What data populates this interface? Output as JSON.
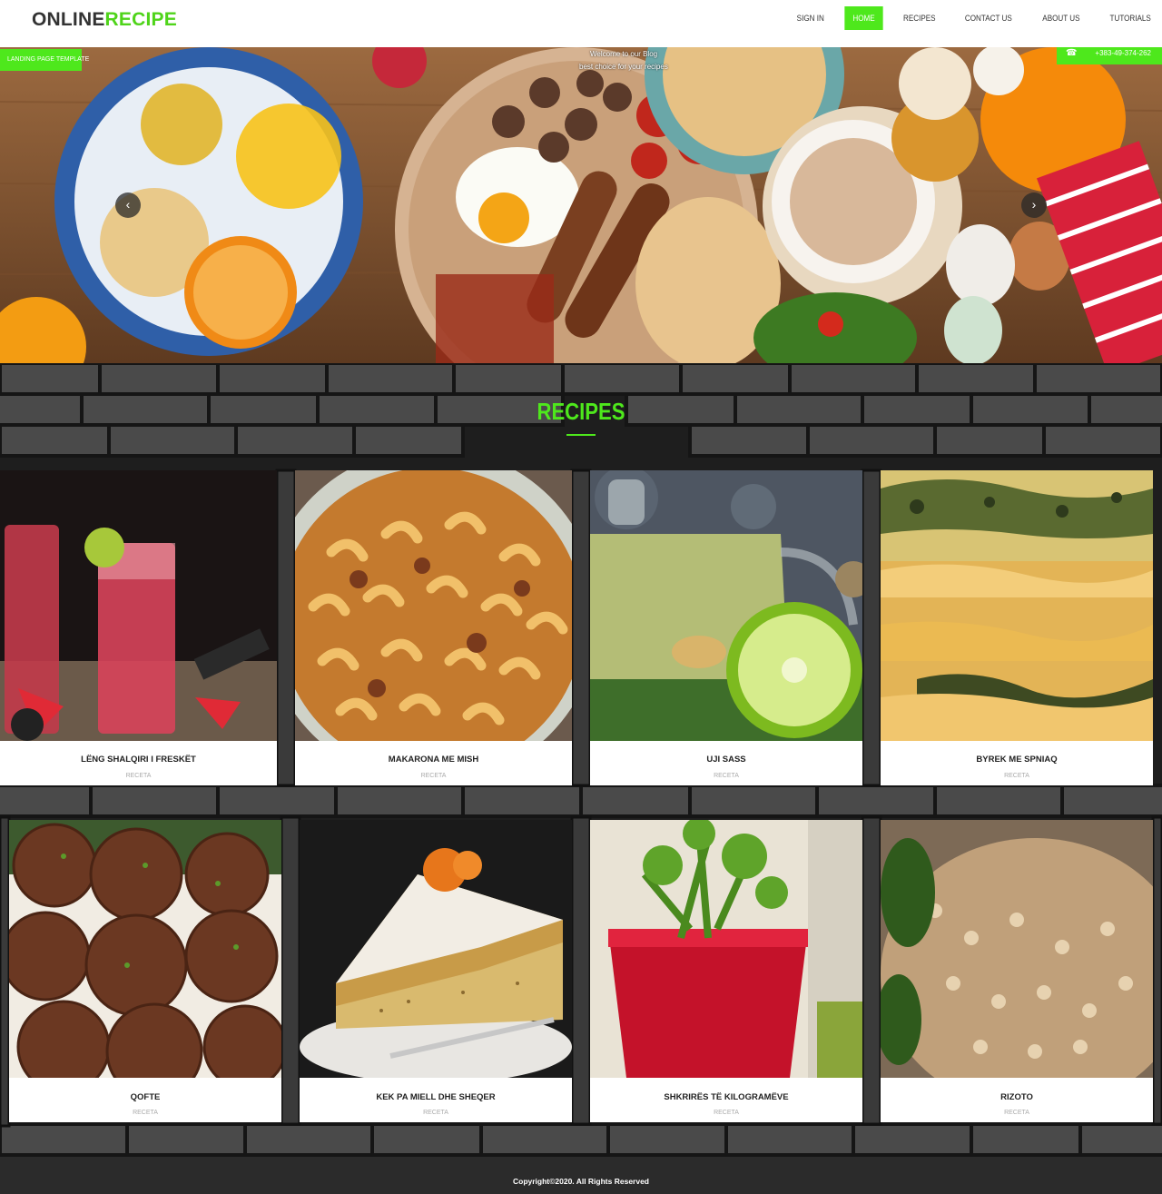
{
  "header": {
    "logo_part1": "ONLINE",
    "logo_part2": "RECIPE",
    "nav": [
      {
        "label": "SIGN IN",
        "active": false
      },
      {
        "label": "HOME",
        "active": true
      },
      {
        "label": "RECIPES",
        "active": false
      },
      {
        "label": "CONTACT US",
        "active": false
      },
      {
        "label": "ABOUT US",
        "active": false
      },
      {
        "label": "TUTORIALS",
        "active": false
      }
    ]
  },
  "hero": {
    "tag_left": "LANDING PAGE TEMPLATE",
    "phone_icon": "phone-icon",
    "phone": "+383-49-374-262",
    "welcome_line1": "Welcome to our Blog",
    "welcome_line2": "best choice for your recipes",
    "prev_icon": "chevron-left-icon",
    "next_icon": "chevron-right-icon"
  },
  "recipes": {
    "title": "RECIPES",
    "cards": [
      {
        "name": "LËNG SHALQIRI I FRESKËT",
        "category": "RECETA"
      },
      {
        "name": "MAKARONA ME MISH",
        "category": "RECETA"
      },
      {
        "name": "UJI SASS",
        "category": "RECETA"
      },
      {
        "name": "BYREK ME SPNIAQ",
        "category": "RECETA"
      },
      {
        "name": "QOFTE",
        "category": "RECETA"
      },
      {
        "name": "KEK PA MIELL DHE SHEQER",
        "category": "RECETA"
      },
      {
        "name": "SHKRIRËS TË KILOGRAMËVE",
        "category": "RECETA"
      },
      {
        "name": "RIZOTO",
        "category": "RECETA"
      }
    ]
  },
  "footer": {
    "copyright": "Copyright©2020. All Rights Reserved"
  },
  "colors": {
    "accent": "#4ee81c",
    "dark": "#2b2b2b"
  }
}
